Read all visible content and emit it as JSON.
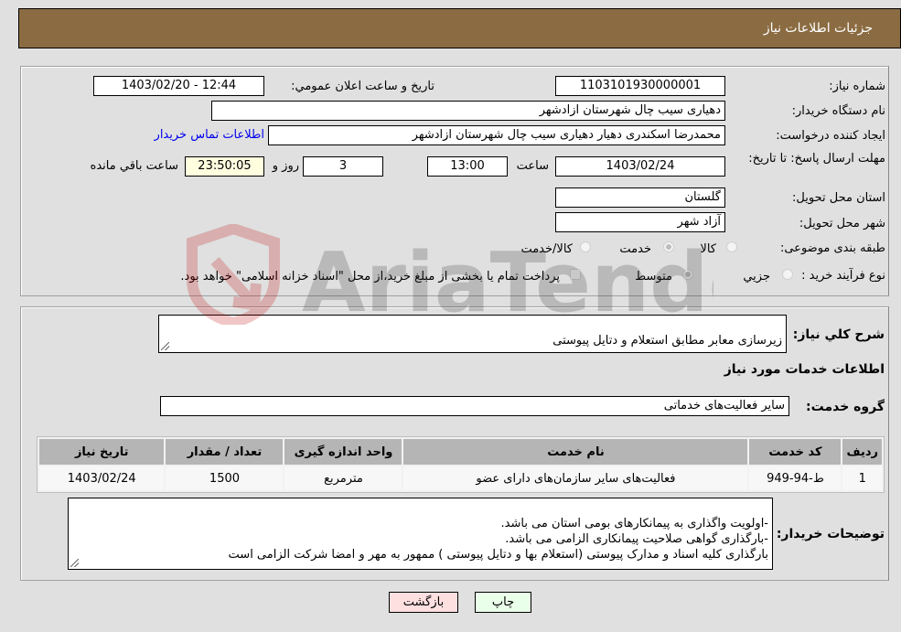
{
  "header": {
    "title": "جزئیات اطلاعات نیاز"
  },
  "fields": {
    "need_number_label": "شماره نیاز:",
    "need_number": "1103101930000001",
    "announce_label": "تاریخ و ساعت اعلان عمومي:",
    "announce_value": "1403/02/20 - 12:44",
    "buyer_org_label": "نام دستگاه خريدار:",
    "buyer_org": "دهیاری سیب چال شهرستان ازادشهر",
    "requester_label": "ایجاد کننده درخواست:",
    "requester": "محمدرضا اسکندری دهیار دهیاری سیب چال شهرستان ازادشهر",
    "contact_link": "اطلاعات تماس خریدار",
    "deadline_label": "مهلت ارسال پاسخ: تا تاریخ:",
    "deadline_date": "1403/02/24",
    "time_label": "ساعت",
    "deadline_time": "13:00",
    "days_value": "3",
    "days_label": "روز و",
    "remaining_time": "23:50:05",
    "remaining_label": "ساعت باقي مانده",
    "province_label": "استان محل تحویل:",
    "province": "گلستان",
    "city_label": "شهر محل تحویل:",
    "city": "آزاد شهر",
    "category_label": "طبقه بندی موضوعی:",
    "category_options": [
      "کالا",
      "خدمت",
      "کالا/خدمت"
    ],
    "category_selected": "خدمت",
    "process_label": "نوع فرآیند خرید :",
    "process_options": [
      "جزيي",
      "متوسط"
    ],
    "process_selected": "متوسط",
    "treasury_note": "پرداخت تمام یا بخشی از مبلغ خرید،از محل \"اسناد خزانه اسلامی\" خواهد بود."
  },
  "details": {
    "summary_label": "شرح کلي نياز:",
    "summary": "زیرسازی معابر مطابق استعلام و دتایل پیوستی",
    "services_heading": "اطلاعات خدمات مورد نياز",
    "service_group_label": "گروه خدمت:",
    "service_group": "سایر فعالیت‌های خدماتی"
  },
  "table": {
    "headers": [
      "ردیف",
      "کد خدمت",
      "نام خدمت",
      "واحد اندازه گیری",
      "تعداد / مقدار",
      "تاریخ نیاز"
    ],
    "rows": [
      [
        "1",
        "ط-94-949",
        "فعالیت‌های سایر سازمان‌های دارای عضو",
        "مترمربع",
        "1500",
        "1403/02/24"
      ]
    ]
  },
  "buyer_notes": {
    "label": "توضیحات خریدار:",
    "text": "-اولویت واگذاری به پیمانکارهای بومی استان می باشد.\n-بارگذاری گواهی صلاحیت پیمانکاری الزامی می باشد.\nبارگذاری کلیه اسناد و مدارک پیوستی (استعلام بها و دتایل پیوستی ) ممهور به مهر و امضا شرکت الزامی است"
  },
  "buttons": {
    "back": "بازگشت",
    "print": "چاپ"
  },
  "watermark": "AriaTender.neT"
}
